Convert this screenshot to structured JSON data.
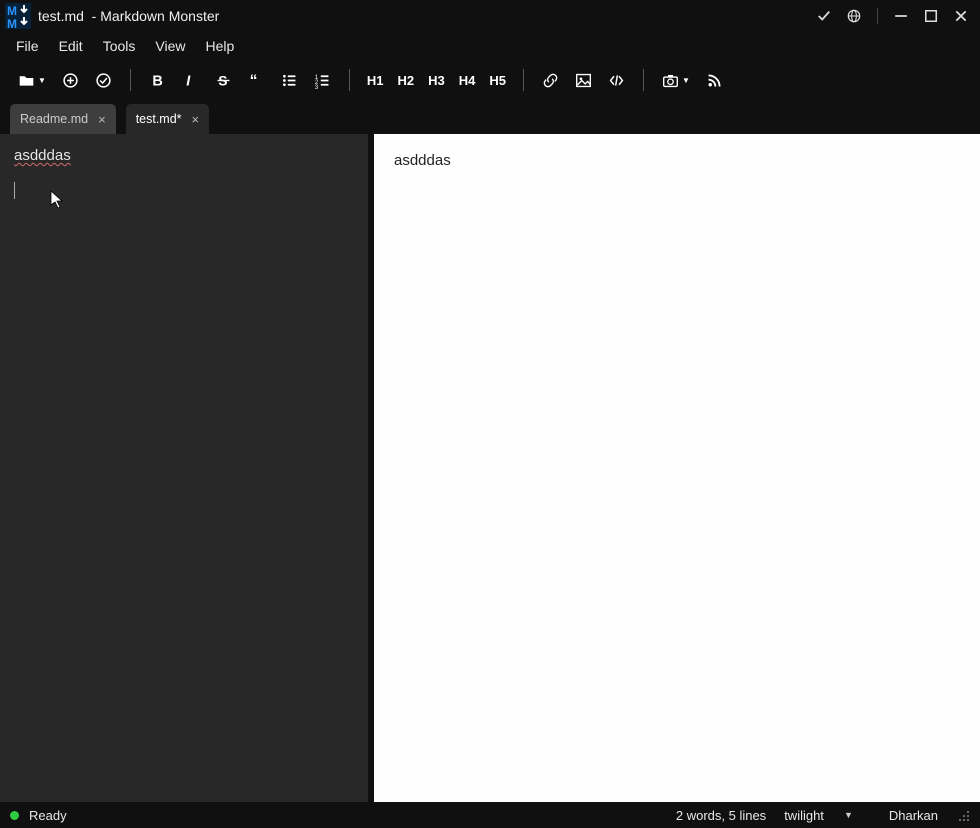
{
  "titlebar": {
    "filename": "test.md",
    "app_name": "Markdown Monster"
  },
  "menubar": {
    "file": "File",
    "edit": "Edit",
    "tools": "Tools",
    "view": "View",
    "help": "Help"
  },
  "toolbar": {
    "h1": "H1",
    "h2": "H2",
    "h3": "H3",
    "h4": "H4",
    "h5": "H5"
  },
  "tabs": [
    {
      "label": "Readme.md",
      "active": false
    },
    {
      "label": "test.md*",
      "active": true
    }
  ],
  "editor": {
    "content": "asdddas"
  },
  "preview": {
    "content": "asdddas"
  },
  "statusbar": {
    "status": "Ready",
    "word_line_count": "2 words, 5 lines",
    "theme": "twilight",
    "preview_theme": "Dharkan"
  }
}
